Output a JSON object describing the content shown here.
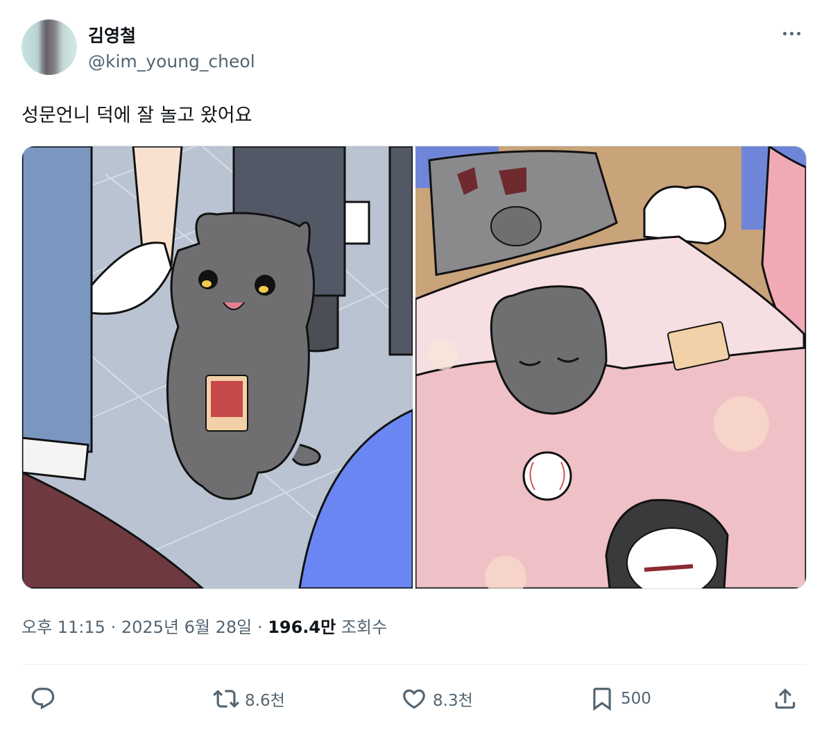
{
  "author": {
    "display_name": "김영철",
    "handle": "@kim_young_cheol"
  },
  "tweet": {
    "text": "성문언니 덕에 잘 놀고 왔어요"
  },
  "media": {
    "left_image_icon": "crying-cat-holding-photocard",
    "right_image_icon": "sleeping-cat-in-bed"
  },
  "meta": {
    "time": "오후 11:15",
    "separator": "·",
    "date": "2025년 6월 28일",
    "views_count": "196.4만",
    "views_label": "조회수"
  },
  "actions": {
    "reply_icon": "reply-icon",
    "retweet_count": "8.6천",
    "like_count": "8.3천",
    "bookmark_count": "500",
    "share_icon": "share-icon"
  },
  "colors": {
    "text_primary": "#0f1419",
    "text_secondary": "#536471",
    "border": "#cfd9de"
  }
}
